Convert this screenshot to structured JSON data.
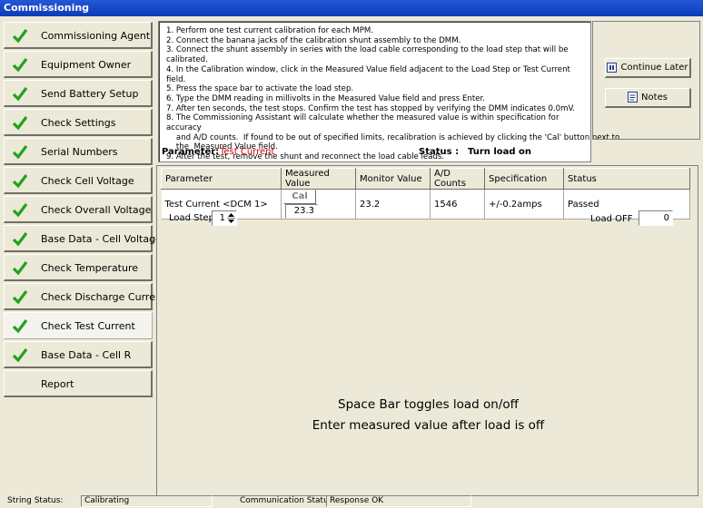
{
  "window": {
    "title": "Commissioning"
  },
  "sidebar": {
    "items": [
      {
        "label": "Commissioning Agent",
        "checked": true
      },
      {
        "label": "Equipment Owner",
        "checked": true
      },
      {
        "label": "Send Battery Setup",
        "checked": true
      },
      {
        "label": "Check Settings",
        "checked": true
      },
      {
        "label": "Serial Numbers",
        "checked": true
      },
      {
        "label": "Check Cell Voltage",
        "checked": true
      },
      {
        "label": "Check Overall Voltage",
        "checked": true
      },
      {
        "label": "Base Data - Cell Voltage",
        "checked": true
      },
      {
        "label": "Check Temperature",
        "checked": true
      },
      {
        "label": "Check Discharge Current",
        "checked": true
      },
      {
        "label": "Check Test Current",
        "checked": true,
        "active": true
      },
      {
        "label": "Base Data - Cell R",
        "checked": true
      },
      {
        "label": "Report",
        "checked": false
      }
    ]
  },
  "instructions": [
    "1. Perform one test current calibration for each MPM.",
    "2. Connect the banana jacks of the calibration shunt assembly to the DMM.",
    "3. Connect the shunt assembly in series with the load cable corresponding to the load step that will be calibrated.",
    "4. In the Calibration window, click in the Measured Value field adjacent to the Load Step or Test Current field.",
    "5. Press the space bar to activate the load step.",
    "6. Type the DMM reading in millivolts in the Measured Value field and press Enter.",
    "7. After ten seconds, the test stops. Confirm the test has stopped by verifying the DMM indicates 0.0mV.",
    "8. The Commissioning Assistant will calculate whether the measured value is within specification for accuracy",
    "    and A/D counts.  If found to be out of specified limits, recalibration is achieved by clicking the 'Cal' button next to",
    "    the  Measured Value field.",
    "9. After the test, remove the shunt and reconnect the load cable leads."
  ],
  "parameter": {
    "label": "Parameter:",
    "value": "Test Current"
  },
  "status": {
    "label": "Status :",
    "value": "Turn load on"
  },
  "buttons": {
    "continue_later": "Continue Later",
    "notes": "Notes"
  },
  "table": {
    "headers": [
      "Parameter",
      "Measured Value",
      "Monitor Value",
      "A/D Counts",
      "Specification",
      "Status"
    ],
    "rows": [
      {
        "parameter": "Test Current <DCM 1>",
        "cal": "Cal",
        "measured": "23.3",
        "monitor": "23.2",
        "ad_counts": "1546",
        "specification": "+/-0.2amps",
        "status": "Passed"
      }
    ]
  },
  "load_step": {
    "label": "Load Step",
    "value": "1"
  },
  "load_off": {
    "label": "Load OFF",
    "value": "0"
  },
  "messages": {
    "line1": "Space Bar toggles load on/off",
    "line2": "Enter measured value after load is off"
  },
  "statusbar": {
    "string_status_label": "String Status:",
    "string_status_value": "Calibrating",
    "comm_status_label": "Communication Status:",
    "comm_status_value": "Response OK"
  },
  "colors": {
    "check": "#1fa31f",
    "parameter_value": "#d40000",
    "title_bar": "#0a3cb8"
  }
}
